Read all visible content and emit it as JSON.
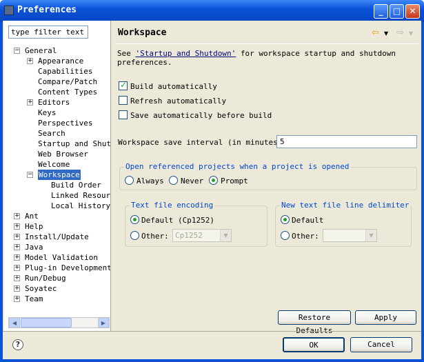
{
  "window": {
    "title": "Preferences"
  },
  "filter": {
    "value": "type filter text"
  },
  "tree": [
    {
      "label": "General",
      "expander": "−"
    },
    {
      "label": "Appearance",
      "expander": "+"
    },
    {
      "label": "Capabilities",
      "expander": ""
    },
    {
      "label": "Compare/Patch",
      "expander": ""
    },
    {
      "label": "Content Types",
      "expander": ""
    },
    {
      "label": "Editors",
      "expander": "+"
    },
    {
      "label": "Keys",
      "expander": ""
    },
    {
      "label": "Perspectives",
      "expander": ""
    },
    {
      "label": "Search",
      "expander": ""
    },
    {
      "label": "Startup and Shutd",
      "expander": ""
    },
    {
      "label": "Web Browser",
      "expander": ""
    },
    {
      "label": "Welcome",
      "expander": ""
    },
    {
      "label": "Workspace",
      "expander": "−"
    },
    {
      "label": "Build Order",
      "expander": ""
    },
    {
      "label": "Linked Resourc",
      "expander": ""
    },
    {
      "label": "Local History",
      "expander": ""
    },
    {
      "label": "Ant",
      "expander": "+"
    },
    {
      "label": "Help",
      "expander": "+"
    },
    {
      "label": "Install/Update",
      "expander": "+"
    },
    {
      "label": "Java",
      "expander": "+"
    },
    {
      "label": "Model Validation",
      "expander": "+"
    },
    {
      "label": "Plug-in Development",
      "expander": "+"
    },
    {
      "label": "Run/Debug",
      "expander": "+"
    },
    {
      "label": "Soyatec",
      "expander": "+"
    },
    {
      "label": "Team",
      "expander": "+"
    }
  ],
  "page": {
    "title": "Workspace",
    "intro_pre": "See ",
    "intro_link": "'Startup and Shutdown'",
    "intro_post": " for workspace startup and shutdown",
    "intro_line2": "preferences.",
    "build_auto": {
      "label": "Build automatically",
      "checked": true
    },
    "refresh_auto": {
      "label": "Refresh automatically",
      "checked": false
    },
    "save_auto": {
      "label": "Save automatically before build",
      "checked": false
    },
    "save_interval_label": "Workspace save interval (in minutes):",
    "save_interval_value": "5",
    "open_projects": {
      "label": "Open referenced projects when a project is opened",
      "options": [
        "Always",
        "Never",
        "Prompt"
      ],
      "selected": "Prompt"
    },
    "encoding": {
      "label": "Text file encoding",
      "default_label": "Default (Cp1252)",
      "other_label": "Other:",
      "other_value": "Cp1252"
    },
    "delimiter": {
      "label": "New text file line delimiter",
      "default_label": "Default",
      "other_label": "Other:",
      "other_value": ""
    },
    "restore_defaults": "Restore Defaults",
    "apply": "Apply"
  },
  "footer": {
    "ok": "OK",
    "cancel": "Cancel",
    "help": "?"
  },
  "colors": {
    "selection": "#316ac5",
    "group_label": "#0046d5",
    "titlebar": "#0a52d8"
  }
}
